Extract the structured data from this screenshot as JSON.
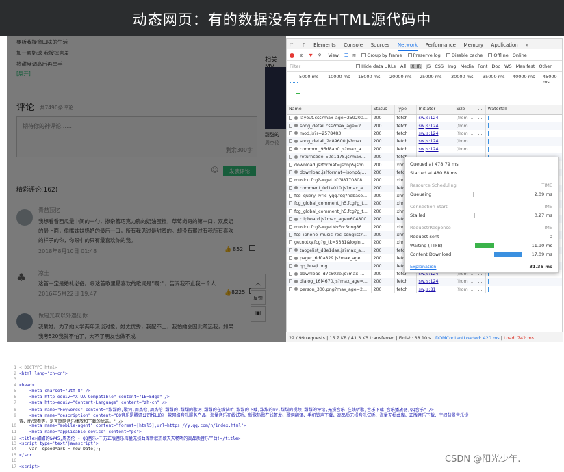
{
  "banner": {
    "title": "动态网页：有的数据没有存在HTML源代码中"
  },
  "page": {
    "lyrics": [
      "要听我操窗口味的生活",
      "加一颗奶球 我按摔害羞",
      "将甜度调高后再牵手"
    ],
    "expand": "[展开]",
    "comment_title": "评论",
    "comment_count": "共7490条评论",
    "comment_placeholder": "期待你的神评论……",
    "remaining": "剩余300字",
    "submit": "发表评论",
    "hot_title": "精彩评论(162)",
    "comments": [
      {
        "user": "青苔顶忆",
        "text1": "我想看看西瓜最中间的一勺，掺杂着巧克力脆的奶油蛋糕，草莓尚奇的第一口，双皮奶",
        "text2": "的最上面，偷嘴妹妹奶奶的最后一口，所有我见过最甜蜜的。却没有那过有我所有喜欢",
        "text3": "的样子的你，你眼中的只有最喜欢你的我。",
        "date": "2018年8月10日 01:48",
        "likes": "852"
      },
      {
        "user": "凉土",
        "text1": "这首一定是婚礼必备。😄这首歌里最喜欢的歌词是“啊：”，告诉我不止我一个人",
        "date": "2016年5月22日 19:47",
        "likes": "8225"
      },
      {
        "user": "做是光吹以外遇见你",
        "text1": "我爱她。为了她大学两年没谈对象。她太优秀，我配不上，我怕她会因此疏远我，如果",
        "text2": "我考520我就不怕了，大不了朋友也做不成"
      }
    ],
    "side_title": "相关MV",
    "side_caption": "甜甜的",
    "side_sub": "周杰伦",
    "float_feedback": "反馈"
  },
  "devtools": {
    "tabs": [
      "Elements",
      "Console",
      "Sources",
      "Network",
      "Performance",
      "Memory",
      "Application",
      "»"
    ],
    "selected_tab": "Network",
    "toolbar": {
      "view": "View:",
      "group_by_frame": "Group by frame",
      "preserve_log": "Preserve log",
      "disable_cache": "Disable cache",
      "offline": "Offline",
      "online": "Online"
    },
    "filter": {
      "placeholder": "Filter",
      "hide_data_urls": "Hide data URLs",
      "types": [
        "All",
        "XHR",
        "JS",
        "CSS",
        "Img",
        "Media",
        "Font",
        "Doc",
        "WS",
        "Manifest",
        "Other"
      ],
      "selected_type": "XHR"
    },
    "timeline_ticks": [
      "5000 ms",
      "10000 ms",
      "15000 ms",
      "20000 ms",
      "25000 ms",
      "30000 ms",
      "35000 ms",
      "40000 ms",
      "45000 ms"
    ],
    "columns": [
      "Name",
      "Status",
      "Type",
      "Initiator",
      "Size",
      "...",
      "Waterfall"
    ],
    "rows": [
      {
        "name": "layout.css?max_age=259200...",
        "status": "200",
        "type": "fetch",
        "initiator": "sw.js:124",
        "size": "(from ...",
        "t": "..."
      },
      {
        "name": "song_detail.css?max_age=2...",
        "status": "200",
        "type": "fetch",
        "initiator": "sw.js:124",
        "size": "(from ...",
        "t": "..."
      },
      {
        "name": "mod.js?r=2578483",
        "status": "200",
        "type": "fetch",
        "initiator": "sw.js:124",
        "size": "(from ...",
        "t": "..."
      },
      {
        "name": "song_detail_2c89600.js?max...",
        "status": "200",
        "type": "fetch",
        "initiator": "sw.js:124",
        "size": "(from ...",
        "t": "..."
      },
      {
        "name": "common_96d8ab0.js?max_a...",
        "status": "200",
        "type": "fetch",
        "initiator": "sw.js:124",
        "size": "(from ...",
        "t": "..."
      },
      {
        "name": "returncode_50d1d78.js?max...",
        "status": "200",
        "type": "fetch",
        "initiator": "",
        "size": "",
        "t": ""
      },
      {
        "name": "download.js?format=jsonp&json...",
        "status": "200",
        "type": "xhr",
        "initiator": "",
        "size": "",
        "t": ""
      },
      {
        "name": "download.js?format=jsonp&j...",
        "status": "200",
        "type": "fetch",
        "initiator": "",
        "size": "",
        "t": ""
      },
      {
        "name": "musicu.fcg?-=getUCGI8770808...",
        "status": "200",
        "type": "xhr",
        "initiator": "",
        "size": "",
        "t": ""
      },
      {
        "name": "comment_0d1e010.js?max_a...",
        "status": "200",
        "type": "fetch",
        "initiator": "",
        "size": "",
        "t": ""
      },
      {
        "name": "fcg_query_lyric_yqq.fcg?nobase...",
        "status": "200",
        "type": "xhr",
        "initiator": "",
        "size": "",
        "t": ""
      },
      {
        "name": "fcg_global_comment_h5.fcg?g_t...",
        "status": "200",
        "type": "xhr",
        "initiator": "",
        "size": "",
        "t": ""
      },
      {
        "name": "fcg_global_comment_h5.fcg?g_t...",
        "status": "200",
        "type": "xhr",
        "initiator": "",
        "size": "",
        "t": ""
      },
      {
        "name": "clipboard.js?max_age=604800",
        "status": "200",
        "type": "fetch",
        "initiator": "",
        "size": "",
        "t": ""
      },
      {
        "name": "musicu.fcg?-=getMvForSong86...",
        "status": "200",
        "type": "xhr",
        "initiator": "",
        "size": "",
        "t": ""
      },
      {
        "name": "fcg_iphone_music_rec_songlist?...",
        "status": "200",
        "type": "xhr",
        "initiator": "",
        "size": "",
        "t": ""
      },
      {
        "name": "getnotky.fcg?g_tk=5381&login...",
        "status": "200",
        "type": "xhr",
        "initiator": "",
        "size": "",
        "t": ""
      },
      {
        "name": "taogelist_d8e1daa.js?max_a...",
        "status": "200",
        "type": "fetch",
        "initiator": "",
        "size": "",
        "t": ""
      },
      {
        "name": "pager_6d0a829.js?max_age...",
        "status": "200",
        "type": "fetch",
        "initiator": "",
        "size": "",
        "t": ""
      },
      {
        "name": "qq_huaji.png",
        "status": "200",
        "type": "fetch",
        "initiator": "",
        "size": "",
        "t": ""
      },
      {
        "name": "download_d7c602e.js?max_...",
        "status": "200",
        "type": "fetch",
        "initiator": "sw.js:124",
        "size": "(from ...",
        "t": "..."
      },
      {
        "name": "dialog_16f4670.js?max_age=...",
        "status": "200",
        "type": "fetch",
        "initiator": "sw.js:124",
        "size": "(from ...",
        "t": "..."
      },
      {
        "name": "person_300.png?max_age=2...",
        "status": "200",
        "type": "fetch",
        "initiator": "sw.js:81",
        "size": "(from ...",
        "t": "..."
      }
    ],
    "timing": {
      "queued_at": "Queued at 478.79 ms",
      "started_at": "Started at 480.88 ms",
      "resource_scheduling": "Resource Scheduling",
      "time": "TIME",
      "queueing": "Queueing",
      "queueing_v": "2.09 ms",
      "connection_start": "Connection Start",
      "stalled": "Stalled",
      "stalled_v": "0.27 ms",
      "request_response": "Request/Response",
      "request_sent": "Request sent",
      "request_sent_v": "0",
      "waiting": "Waiting (TTFB)",
      "waiting_v": "11.90 ms",
      "content_download": "Content Download",
      "content_download_v": "17.09 ms",
      "explanation": "Explanation",
      "total": "31.36 ms",
      "colors": {
        "waiting": "#3bb34a",
        "download": "#3b90e0"
      }
    },
    "status_bar": {
      "summary": "22 / 99 requests | 15.7 KB / 41.3 KB transferred | Finish: 38.10 s | ",
      "dcl": "DOMContentLoaded: 420 ms",
      "sep": " | ",
      "load": "Load: 742 ms"
    }
  },
  "code": {
    "lines": [
      {
        "n": "1",
        "t": "<!DOCTYPE html>"
      },
      {
        "n": "2",
        "t": "<html lang=\"zh-cn\">"
      },
      {
        "n": "3",
        "t": ""
      },
      {
        "n": "4",
        "t": "<head>"
      },
      {
        "n": "5",
        "t": "    <meta charset=\"utf-8\" />"
      },
      {
        "n": "6",
        "t": "    <meta http-equiv=\"X-UA-Compatible\" content=\"IE=Edge\" />"
      },
      {
        "n": "7",
        "t": "    <meta http-equiv=\"Content-Language\" content=\"zh-cn\" />"
      },
      {
        "n": "8",
        "t": "    <meta name=\"keywords\" content=\"甜甜的,歌词,周杰伦,周杰伦 甜甜的,甜甜的歌词,甜甜的在线试听,甜甜的下载,甜甜的mv,甜甜的视频,甜甜的评论,无损音乐,在线听歌,音乐下载,音乐播放器,QQ音乐\" />"
      },
      {
        "n": "9",
        "t": "    <meta name=\"description\" content=\"QQ音乐是腾讯公司推出的一款网络音乐服务产品，海量音乐在线试听、新歌热歌在线首发、歌词翻译、手机铃声下载、高品质无损音乐试听、海量无损曲库、正版音乐下载、空间背景音乐设"
      },
      {
        "n": "",
        "t": "置、MV观看等，是互联网音乐播放和下载的优选。\" />"
      },
      {
        "n": "10",
        "t": "    <meta name=\"mobile-agent\" content=\"format=[html5];url=https://y.qq.com/n/index.html\">"
      },
      {
        "n": "11",
        "t": "    <meta name=\"applicable-device\" content=\"pc\">"
      },
      {
        "n": "12",
        "t": "<title>甜甜的&#45;周杰伦 - QQ音乐-千万正版音乐海量无损曲库新歌热歌天天畅听的高品质音乐平台!</title>"
      },
      {
        "n": "13",
        "t": "<script type=\"text/javascript\">"
      },
      {
        "n": "14",
        "t": "    var _speedMark = new Date();"
      },
      {
        "n": "15",
        "t": "</scr"
      },
      {
        "n": "16",
        "t": ""
      },
      {
        "n": "17",
        "t": "<script>"
      }
    ]
  },
  "watermark": "CSDN @阳光少年."
}
